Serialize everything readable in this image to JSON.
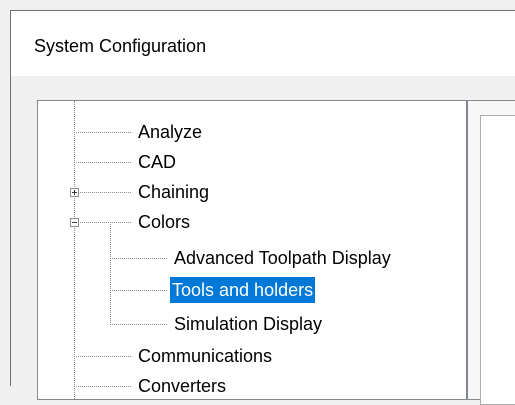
{
  "window": {
    "title": "System Configuration"
  },
  "tree": {
    "items": [
      {
        "label": "Analyze",
        "expander": "none",
        "selected": false
      },
      {
        "label": "CAD",
        "expander": "none",
        "selected": false
      },
      {
        "label": "Chaining",
        "expander": "plus",
        "selected": false
      },
      {
        "label": "Colors",
        "expander": "minus",
        "selected": false
      },
      {
        "label": "Advanced Toolpath Display",
        "expander": "none",
        "selected": false
      },
      {
        "label": "Tools and holders",
        "expander": "none",
        "selected": true
      },
      {
        "label": "Simulation Display",
        "expander": "none",
        "selected": false
      },
      {
        "label": "Communications",
        "expander": "none",
        "selected": false
      },
      {
        "label": "Converters",
        "expander": "none",
        "selected": false
      }
    ]
  },
  "colors": {
    "selection_background": "#0078d7",
    "selection_text": "#ffffff",
    "tree_line": "#8c8c8c"
  }
}
